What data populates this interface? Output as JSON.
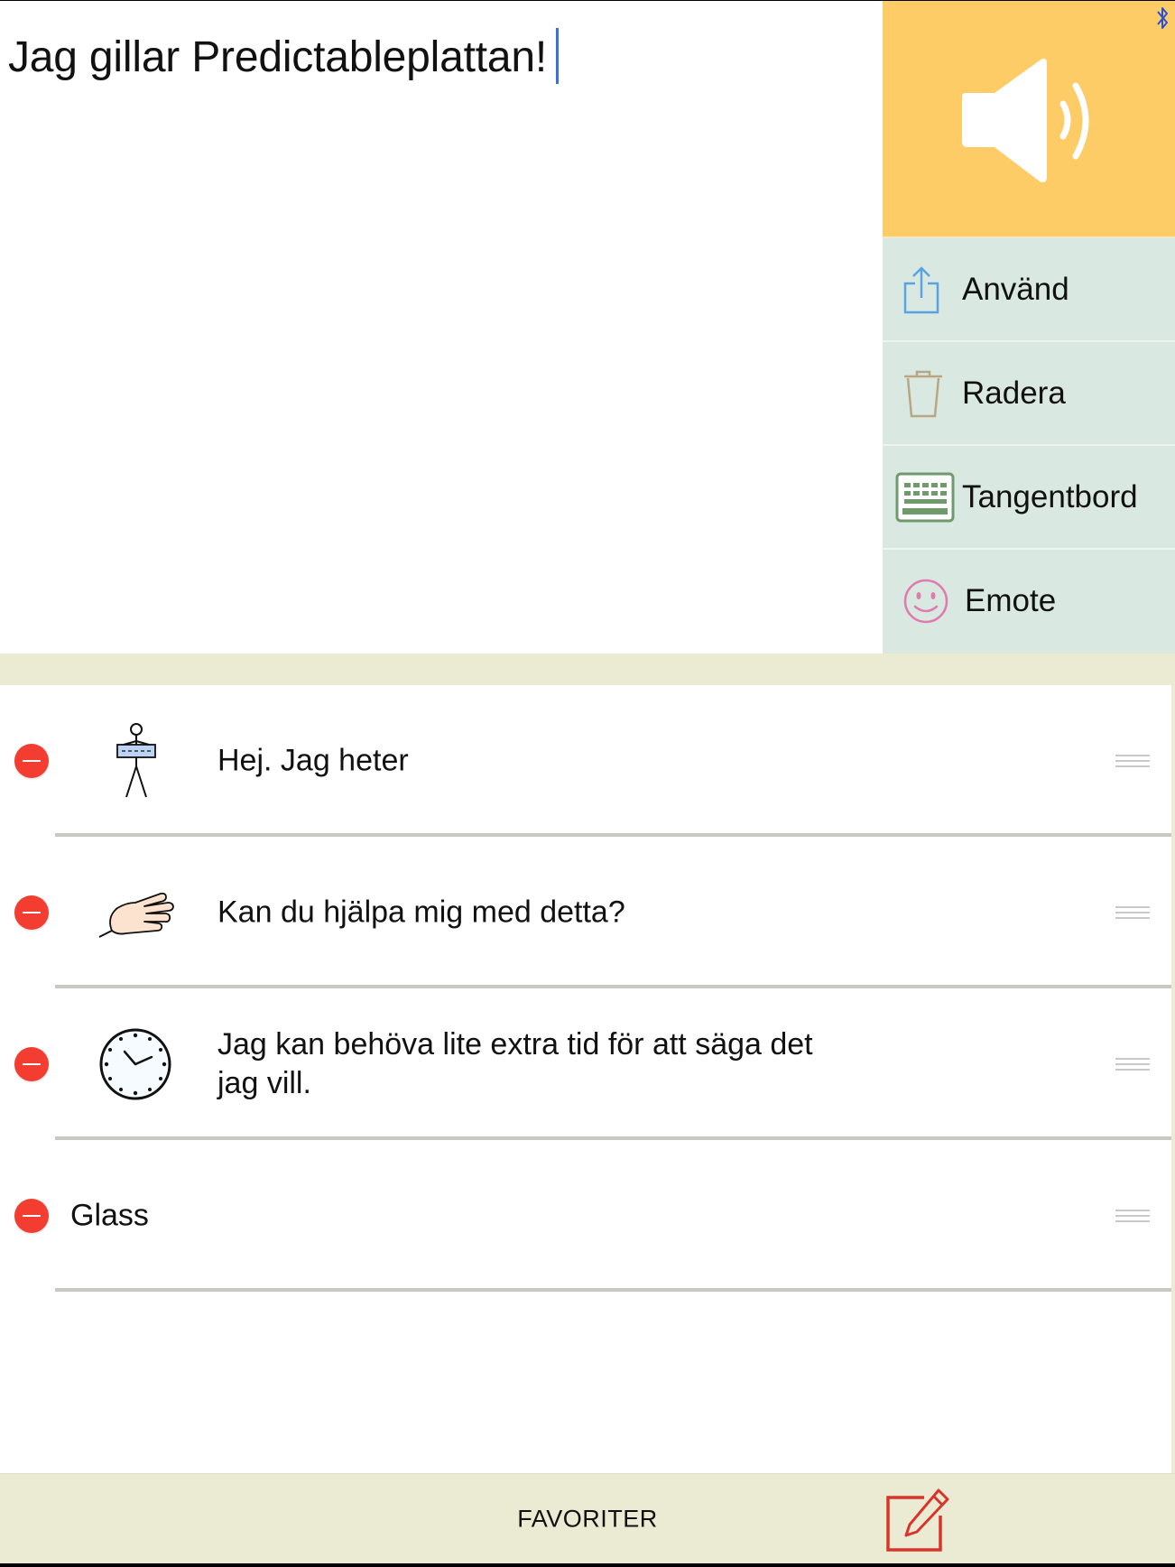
{
  "editor": {
    "text": "Jag gillar Predictableplattan!"
  },
  "speak": {
    "icon": "speaker-icon"
  },
  "status": {
    "icon": "bluetooth-icon",
    "color": "#2b4fd8"
  },
  "actions": [
    {
      "label": "Använd",
      "icon": "share-icon",
      "color": "#5aa3e0"
    },
    {
      "label": "Radera",
      "icon": "trash-icon",
      "color": "#b9a684"
    },
    {
      "label": "Tangentbord",
      "icon": "keyboard-icon",
      "color": "#6f9a6a"
    },
    {
      "label": "Emote",
      "icon": "smiley-icon",
      "color": "#e07bb0"
    }
  ],
  "favorites": {
    "items": [
      {
        "text_line1": "Hej. Jag heter",
        "text_line2": "",
        "symbol": "person-name-tag-icon"
      },
      {
        "text_line1": "Kan du hjälpa mig med detta?",
        "text_line2": "",
        "symbol": "helping-hand-icon"
      },
      {
        "text_line1": "Jag kan behöva lite extra tid för att säga det",
        "text_line2": "jag vill.",
        "symbol": "clock-icon"
      },
      {
        "text_line1": "Glass",
        "text_line2": "",
        "symbol": ""
      }
    ]
  },
  "bottom_bar": {
    "tab_label": "FAVORITER",
    "edit_icon": "edit-icon",
    "edit_color": "#d9342b"
  },
  "colors": {
    "speak_bg": "#fecc66",
    "action_bg": "#d9e8e1",
    "band_bg": "#ebebd3",
    "delete_red": "#f23d30"
  }
}
